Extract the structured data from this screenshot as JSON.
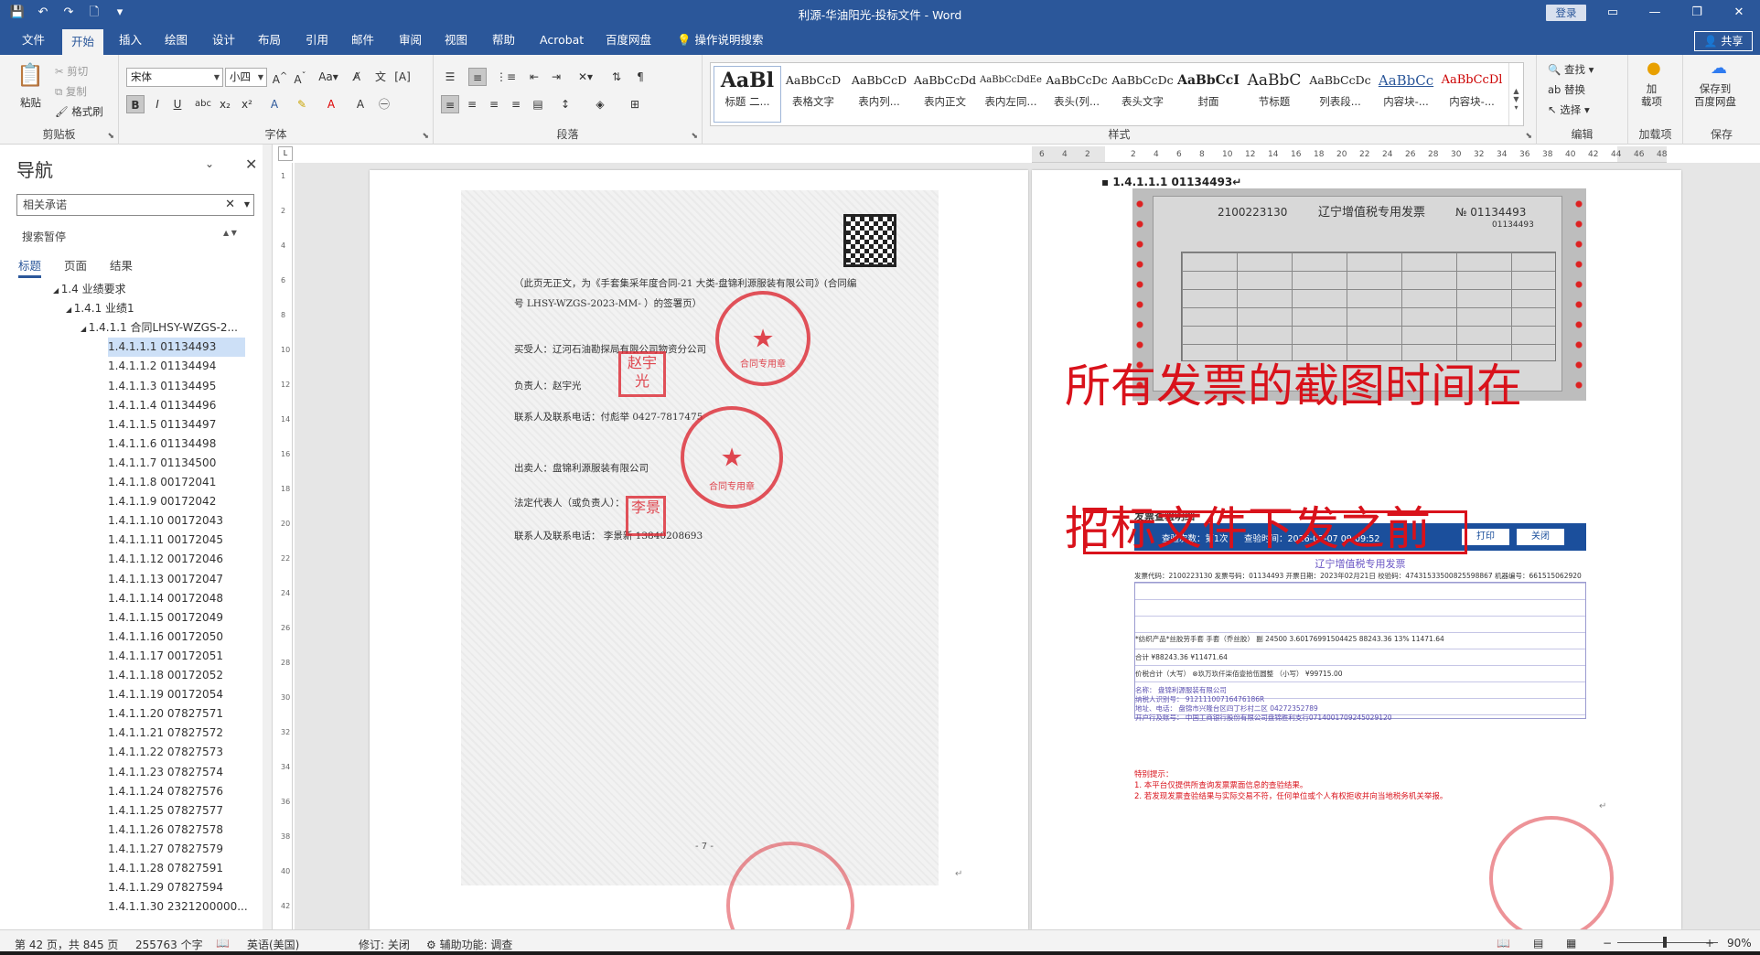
{
  "app": {
    "window_title": "利源-华油阳光-投标文件 - Word",
    "signin_label": "登录",
    "share_label": "共享",
    "tabs": [
      "文件",
      "开始",
      "插入",
      "绘图",
      "设计",
      "布局",
      "引用",
      "邮件",
      "审阅",
      "视图",
      "帮助",
      "Acrobat",
      "百度网盘"
    ],
    "tell_me": "操作说明搜索"
  },
  "ribbon": {
    "clipboard": {
      "paste": "粘贴",
      "cut": "剪切",
      "copy": "复制",
      "format_painter": "格式刷",
      "label": "剪贴板"
    },
    "font": {
      "name": "宋体",
      "size": "小四",
      "label": "字体"
    },
    "paragraph": {
      "label": "段落"
    },
    "styles": {
      "label": "样式",
      "items": [
        {
          "sample": "AaBl",
          "name": "标题 二..."
        },
        {
          "sample": "AaBbCcD",
          "name": "表格文字"
        },
        {
          "sample": "AaBbCcD",
          "name": "表内列..."
        },
        {
          "sample": "AaBbCcDd",
          "name": "表内正文"
        },
        {
          "sample": "AaBbCcDdEe",
          "name": "表内左同..."
        },
        {
          "sample": "AaBbCcDc",
          "name": "表头(列..."
        },
        {
          "sample": "AaBbCcDc",
          "name": "表头文字"
        },
        {
          "sample": "AaBbCcI",
          "name": "封面"
        },
        {
          "sample": "AaBbC",
          "name": "节标题"
        },
        {
          "sample": "AaBbCcDc",
          "name": "列表段..."
        },
        {
          "sample": "AaBbCc",
          "name": "内容块-..."
        },
        {
          "sample": "AaBbCcDl",
          "name": "内容块-..."
        }
      ]
    },
    "editing": {
      "find": "查找",
      "replace": "替换",
      "select": "选择",
      "label": "编辑"
    },
    "addins": {
      "btn": "加\n载项",
      "label": "加载项"
    },
    "baidu": {
      "btn": "保存到\n百度网盘",
      "label": "保存"
    }
  },
  "nav": {
    "title": "导航",
    "search_value": "相关承诺",
    "status": "搜索暂停",
    "tabs": [
      "标题",
      "页面",
      "结果"
    ],
    "tree": [
      {
        "label": "1.4 业绩要求",
        "level": 0
      },
      {
        "label": "1.4.1 业绩1",
        "level": 1
      },
      {
        "label": "1.4.1.1 合同LHSY-WZGS-2...",
        "level": 2
      },
      {
        "label": "1.4.1.1.1 01134493",
        "level": 3,
        "selected": true
      },
      {
        "label": "1.4.1.1.2 01134494",
        "level": 3
      },
      {
        "label": "1.4.1.1.3 01134495",
        "level": 3
      },
      {
        "label": "1.4.1.1.4 01134496",
        "level": 3
      },
      {
        "label": "1.4.1.1.5 01134497",
        "level": 3
      },
      {
        "label": "1.4.1.1.6 01134498",
        "level": 3
      },
      {
        "label": "1.4.1.1.7 01134500",
        "level": 3
      },
      {
        "label": "1.4.1.1.8 00172041",
        "level": 3
      },
      {
        "label": "1.4.1.1.9 00172042",
        "level": 3
      },
      {
        "label": "1.4.1.1.10 00172043",
        "level": 3
      },
      {
        "label": "1.4.1.1.11 00172045",
        "level": 3
      },
      {
        "label": "1.4.1.1.12 00172046",
        "level": 3
      },
      {
        "label": "1.4.1.1.13 00172047",
        "level": 3
      },
      {
        "label": "1.4.1.1.14 00172048",
        "level": 3
      },
      {
        "label": "1.4.1.1.15 00172049",
        "level": 3
      },
      {
        "label": "1.4.1.1.16 00172050",
        "level": 3
      },
      {
        "label": "1.4.1.1.17 00172051",
        "level": 3
      },
      {
        "label": "1.4.1.1.18 00172052",
        "level": 3
      },
      {
        "label": "1.4.1.1.19 00172054",
        "level": 3
      },
      {
        "label": "1.4.1.1.20 07827571",
        "level": 3
      },
      {
        "label": "1.4.1.1.21 07827572",
        "level": 3
      },
      {
        "label": "1.4.1.1.22 07827573",
        "level": 3
      },
      {
        "label": "1.4.1.1.23 07827574",
        "level": 3
      },
      {
        "label": "1.4.1.1.24 07827576",
        "level": 3
      },
      {
        "label": "1.4.1.1.25 07827577",
        "level": 3
      },
      {
        "label": "1.4.1.1.26 07827578",
        "level": 3
      },
      {
        "label": "1.4.1.1.27 07827579",
        "level": 3
      },
      {
        "label": "1.4.1.1.28 07827591",
        "level": 3
      },
      {
        "label": "1.4.1.1.29 07827594",
        "level": 3
      },
      {
        "label": "1.4.1.1.30 2321200000...",
        "level": 3
      }
    ]
  },
  "ruler": {
    "ticks": [
      "6",
      "4",
      "2",
      "",
      "2",
      "4",
      "6",
      "8",
      "10",
      "12",
      "14",
      "16",
      "18",
      "20",
      "22",
      "24",
      "26",
      "28",
      "30",
      "32",
      "34",
      "36",
      "38",
      "40",
      "42",
      "44",
      "46",
      "48"
    ],
    "vticks": [
      "1",
      "2",
      "4",
      "6",
      "8",
      "10",
      "12",
      "14",
      "16",
      "18",
      "20",
      "22",
      "24",
      "26",
      "28",
      "30",
      "32",
      "34",
      "36",
      "38",
      "40",
      "42"
    ]
  },
  "left_page": {
    "line1": "（此页无正文，为《手套集采年度合同-21 大类-盘锦利源服装有限公司》(合同编",
    "line2": "号 LHSY-WZGS-2023-MM-      ）的签署页）",
    "buyer": "买受人：辽河石油勘探局有限公司物资分公司",
    "responsible": "负责人：赵宇光",
    "contact1": "联系人及联系电话：付彪举 0427-7817475",
    "seller": "出卖人：盘锦利源服装有限公司",
    "legal_rep": "法定代表人（或负责人）：",
    "contact2": "联系人及联系电话：  李景新 13840208693",
    "stamp1_text": "合同专用章",
    "stamp2_text": "合同专用章",
    "seal1": "赵宇光",
    "seal2": "李景",
    "page_number": "- 7 -"
  },
  "right_page": {
    "heading": "1.4.1.1.1 01134493",
    "invoice_code": "2100223130",
    "invoice_title": "辽宁增值税专用发票",
    "invoice_no": "№ 01134493",
    "invoice_no_sub": "01134493",
    "annot1": "所有发票的截图时间在",
    "annot2": "招标文件下发之前",
    "verify_title": "发票查验明细",
    "verify_count": "查验次数：第1次",
    "verify_time": "查验时间：2026-02-07 09:09:52",
    "btn_print": "打印",
    "btn_close": "关闭",
    "einvoice_title": "辽宁增值税专用发票",
    "einv_row1": "发票代码：2100223130    发票号码：01134493    开票日期：2023年02月21日    校验码：47431533500825598867    机器编号：661515062920",
    "einv_item": "*纺织产品*丝胶劳手套        手套（乔丝胶）  副   24500   3.60176991504425    88243.36   13%   11471.64",
    "einv_total": "合计                                                                 ¥88243.36          ¥11471.64",
    "einv_sum": "价税合计（大写）  ⊗玖万玖仟柒佰壹拾伍圆整                              （小写）  ¥99715.00",
    "einv_seller1": "名称：     盘锦利源服装有限公司",
    "einv_seller2": "纳税人识别号：  91211100716476186R",
    "einv_seller3": "地址、电话：   盘锦市兴隆台区四丁杉村二区 04272352789",
    "einv_seller4": "开户行及账号：  中国工商银行股份有限公司盘锦胜利支行0714001709245029120",
    "notice_title": "特别提示：",
    "notice1": "1. 本平台仅提供所查询发票票面信息的查验结果。",
    "notice2": "2. 若发现发票查验结果与实际交易不符，任何单位或个人有权拒收并向当地税务机关举报。"
  },
  "status": {
    "page": "第 42 页，共 845 页",
    "words": "255763 个字",
    "lang": "英语(美国)",
    "track": "修订: 关闭",
    "accessibility": "辅助功能: 调查",
    "zoom": "90%"
  }
}
